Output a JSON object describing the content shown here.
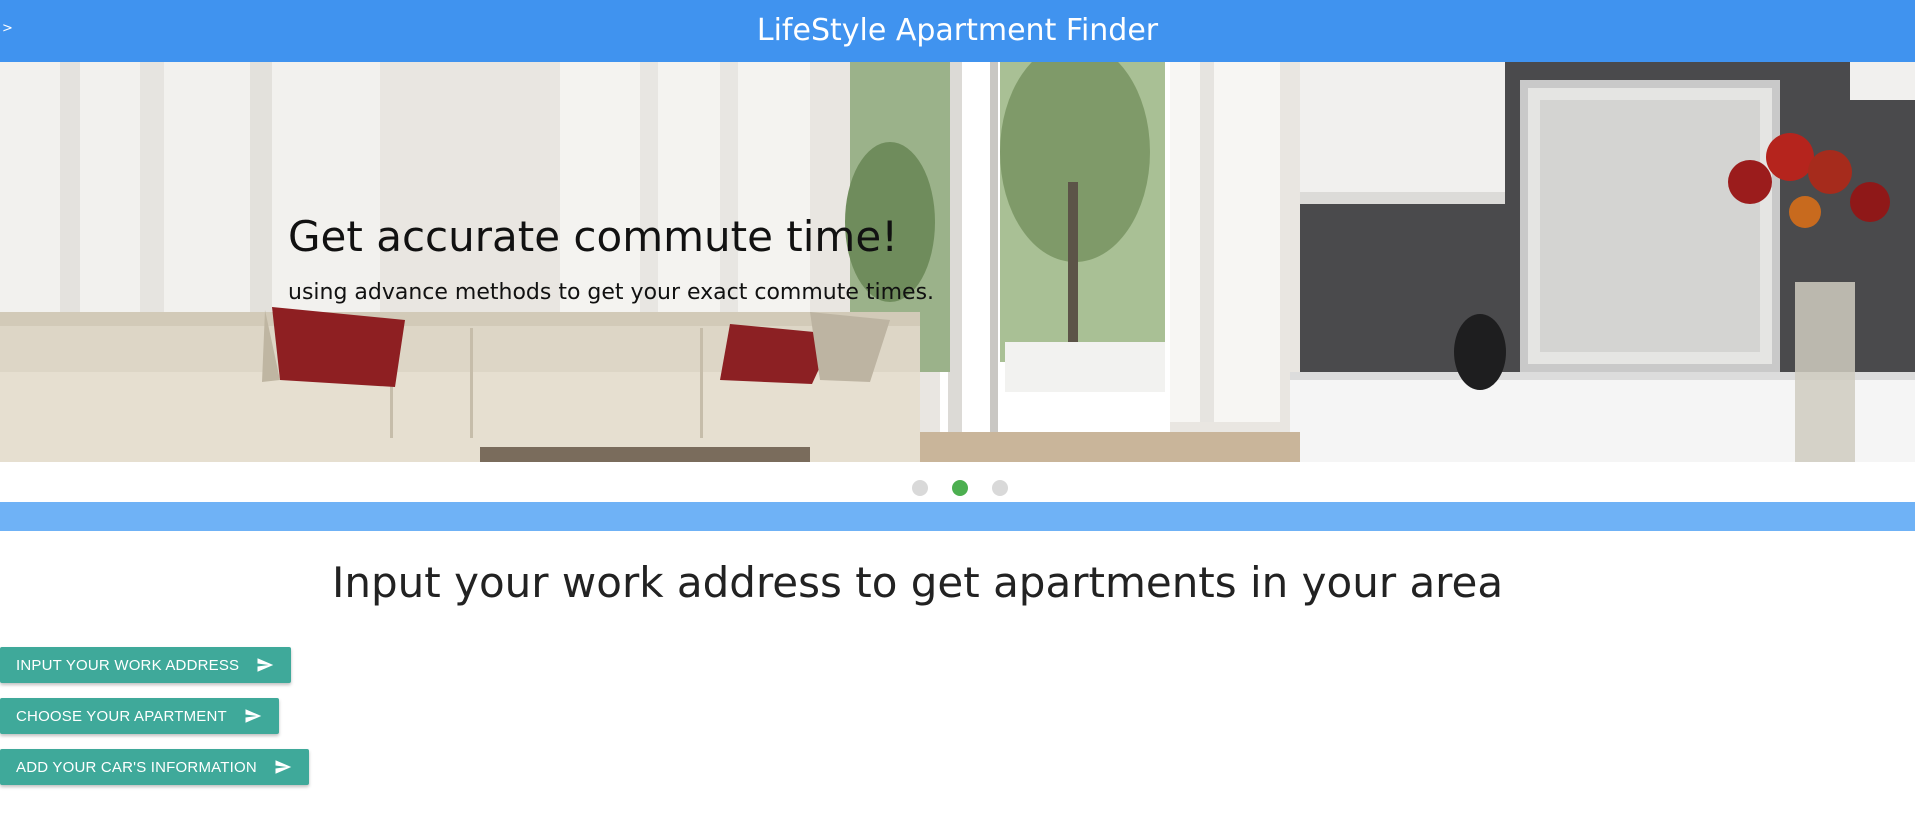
{
  "header": {
    "menu_toggle": ">",
    "title": "LifeStyle Apartment Finder",
    "background_color": "#4093ef"
  },
  "carousel": {
    "heading": "Get accurate commute time!",
    "subtext": "using advance methods to get your exact commute times.",
    "slide_count": 3,
    "active_index": 1,
    "active_dot_color": "#4caf50",
    "inactive_dot_color": "#d9d9d9"
  },
  "main": {
    "title": "Input your work address to get apartments in your area",
    "strip_color": "#6fb2f6",
    "buttons": [
      {
        "label": "Input your work address",
        "icon": "send-icon"
      },
      {
        "label": "Choose your apartment",
        "icon": "send-icon"
      },
      {
        "label": "Add your car's information",
        "icon": "send-icon"
      }
    ],
    "button_color": "#3fa99a"
  }
}
